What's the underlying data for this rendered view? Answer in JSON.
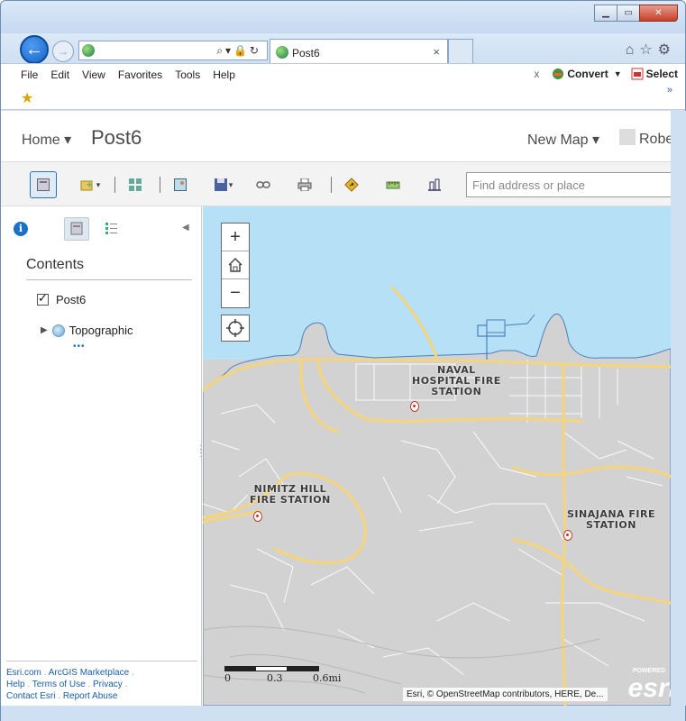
{
  "browser": {
    "tab_title": "Post6",
    "menu": [
      "File",
      "Edit",
      "View",
      "Favorites",
      "Tools",
      "Help"
    ],
    "toolbar_right": {
      "close": "x",
      "convert": "Convert",
      "select": "Select"
    },
    "chevron": "»"
  },
  "header": {
    "home": "Home ▾",
    "title": "Post6",
    "new_map": "New Map ▾",
    "user": "Robe"
  },
  "search": {
    "placeholder": "Find address or place"
  },
  "contents": {
    "heading": "Contents",
    "layer": "Post6",
    "basemap": "Topographic",
    "more": "•••"
  },
  "footer": {
    "links": [
      "Esri.com",
      "ArcGIS Marketplace",
      "Help",
      "Terms of Use",
      "Privacy",
      "Contact Esri",
      "Report Abuse"
    ]
  },
  "map": {
    "zoom_in": "+",
    "zoom_out": "−",
    "labels": {
      "naval": "NAVAL\nHOSPITAL FIRE\nSTATION",
      "nimitz": "NIMITZ HILL\nFIRE STATION",
      "sinajana": "SINAJANA FIRE\nSTATION"
    },
    "scale": [
      "0",
      "0.3",
      "0.6mi"
    ],
    "attribution": "Esri, © OpenStreetMap contributors, HERE, De...",
    "powered": "POWERED",
    "logo": "esri"
  },
  "colors": {
    "water": "#b5e0f5",
    "land": "#d2d2d2",
    "road": "#f6d47a",
    "accent": "#1a72c5"
  }
}
